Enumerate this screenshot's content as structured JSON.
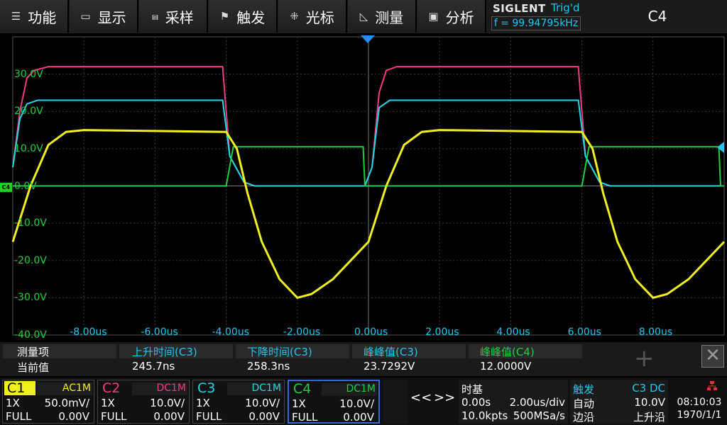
{
  "menu": {
    "items": [
      {
        "icon": "☰",
        "label": "功能"
      },
      {
        "icon": "▭",
        "label": "显示"
      },
      {
        "icon": "⩎",
        "label": "采样"
      },
      {
        "icon": "⚑",
        "label": "触发"
      },
      {
        "icon": "⁜",
        "label": "光标"
      },
      {
        "icon": "◺",
        "label": "测量"
      },
      {
        "icon": "▣",
        "label": "分析"
      }
    ],
    "brand": "SIGLENT",
    "trig_status": "Trig'd",
    "frequency": "f = 99.94795kHz",
    "active_channel": "C4"
  },
  "scope": {
    "y_labels": [
      "30.0V",
      "20.0V",
      "10.0V",
      "0.0V",
      "-10.0V",
      "-20.0V",
      "-30.0V",
      "-40.0V"
    ],
    "x_labels": [
      "-8.00us",
      "-6.00us",
      "-4.00us",
      "-2.00us",
      "0.00us",
      "2.00us",
      "4.00us",
      "6.00us",
      "8.00us"
    ],
    "ground_marker": "C4",
    "colors": {
      "c1": "#f0f020",
      "c2": "#f03c82",
      "c3": "#20d8e8",
      "c4": "#20d040",
      "grid": "#3a3a3a"
    }
  },
  "chart_data": {
    "type": "line",
    "xlabel": "",
    "ylabel": "",
    "xlim": [
      -10,
      10
    ],
    "ylim": [
      -40,
      40
    ],
    "period_us": 10.005,
    "series": [
      {
        "name": "C2",
        "x": [
          -10,
          -9.8,
          -9.6,
          -9.4,
          -9.0,
          -4.1,
          -3.9,
          -3.5,
          -3.2,
          -0.1,
          0.1,
          0.3,
          0.5,
          0.8,
          5.9,
          6.1,
          6.5,
          6.8,
          10
        ],
        "y": [
          5,
          20,
          29,
          31,
          32,
          32,
          8,
          1,
          0,
          0,
          5,
          25,
          31,
          32,
          32,
          8,
          1,
          0,
          0
        ]
      },
      {
        "name": "C3",
        "x": [
          -10,
          -9.8,
          -9.6,
          -9.3,
          -4.1,
          -3.9,
          -3.5,
          -3.2,
          -0.1,
          0.1,
          0.3,
          0.6,
          5.9,
          6.1,
          6.5,
          6.8,
          10
        ],
        "y": [
          5,
          18,
          22,
          23,
          23,
          8,
          1,
          0,
          0,
          5,
          21,
          23,
          23,
          8,
          1,
          0,
          0
        ]
      },
      {
        "name": "C4",
        "x": [
          -10,
          -4.0,
          -3.8,
          -3.75,
          -0.15,
          -0.1,
          0,
          6.0,
          6.2,
          6.25,
          9.85,
          9.9,
          10
        ],
        "y": [
          0,
          0,
          10.5,
          10.5,
          10.5,
          0,
          0,
          0,
          10.5,
          10.5,
          10.5,
          0,
          0
        ]
      },
      {
        "name": "C1",
        "x": [
          -10,
          -9.5,
          -9.0,
          -8.5,
          -8.0,
          -4.0,
          -3.7,
          -3.4,
          -3.0,
          -2.5,
          -2.0,
          -1.6,
          -1.0,
          -0.5,
          0,
          0.5,
          1.0,
          1.5,
          2.0,
          6.0,
          6.3,
          6.6,
          7.0,
          7.5,
          8.0,
          8.4,
          9.0,
          9.5,
          10
        ],
        "y": [
          -15,
          0,
          11,
          14.5,
          15,
          14.5,
          10,
          -2,
          -15,
          -25,
          -30,
          -29,
          -25,
          -20,
          -15,
          0,
          11,
          14.5,
          15,
          14.5,
          10,
          -2,
          -15,
          -25,
          -30,
          -29,
          -25,
          -20,
          -15
        ]
      }
    ]
  },
  "measure": {
    "header_label": "测量项",
    "row_label": "当前值",
    "items": [
      {
        "name": "上升时间(C3)",
        "value": "245.7ns",
        "color": "#20c8f0"
      },
      {
        "name": "下降时间(C3)",
        "value": "258.3ns",
        "color": "#20c8f0"
      },
      {
        "name": "峰峰值(C3)",
        "value": "23.7292V",
        "color": "#20c8f0"
      },
      {
        "name": "峰峰值(C4)",
        "value": "12.0000V",
        "color": "#20d040"
      }
    ]
  },
  "channels": [
    {
      "name": "C1",
      "coupling": "AC1M",
      "probe": "1X",
      "scale": "50.0mV/",
      "bw": "FULL",
      "offset": "0.00V",
      "color": "#f0f020"
    },
    {
      "name": "C2",
      "coupling": "DC1M",
      "probe": "1X",
      "scale": "10.0V/",
      "bw": "FULL",
      "offset": "0.00V",
      "color": "#f03c82"
    },
    {
      "name": "C3",
      "coupling": "DC1M",
      "probe": "1X",
      "scale": "10.0V/",
      "bw": "FULL",
      "offset": "0.00V",
      "color": "#20d8e8"
    },
    {
      "name": "C4",
      "coupling": "DC1M",
      "probe": "1X",
      "scale": "10.0V/",
      "bw": "FULL",
      "offset": "0.00V",
      "color": "#20d040"
    }
  ],
  "nav": {
    "prev": "<<",
    "next": ">>"
  },
  "timebase": {
    "title": "时基",
    "delay": "0.00s",
    "scale": "2.00us/div",
    "memory": "10.0kpts",
    "rate": "500MSa/s"
  },
  "trigger": {
    "title": "触发",
    "source": "C3 DC",
    "mode": "自动",
    "level": "10.0V",
    "type": "边沿",
    "slope": "上升沿"
  },
  "clock": {
    "time": "08:10:03",
    "date": "1970/1/1",
    "icon": "network-icon"
  }
}
